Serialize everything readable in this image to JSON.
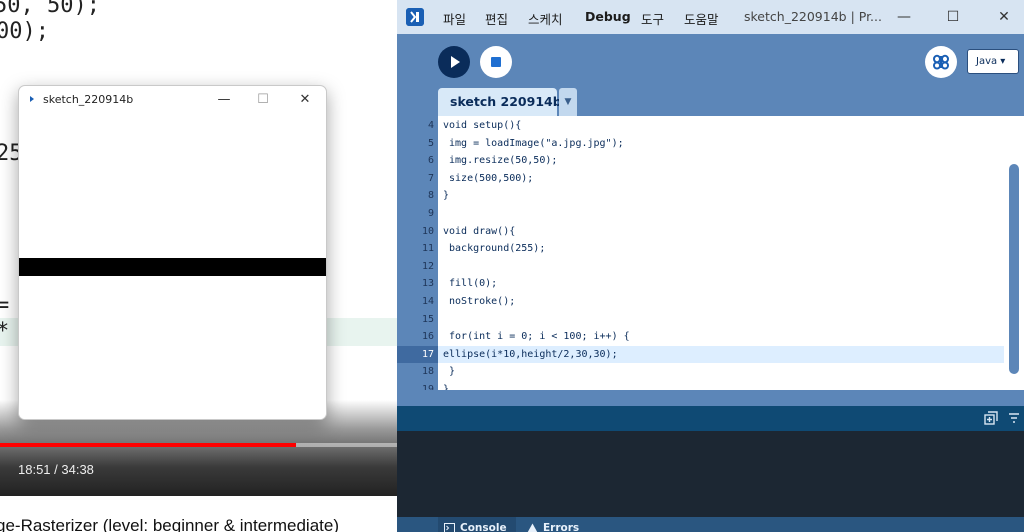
{
  "background_video": {
    "code_lines": [
      "50, 50);",
      "00);",
      "25",
      "=",
      "*"
    ],
    "time": "18:51 / 34:38",
    "progress_fraction": 0.745,
    "caption": "ge-Rasterizer (level: beginner & intermediate)"
  },
  "sketch_window": {
    "title": "sketch_220914b",
    "controls": {
      "minimize": "—",
      "maximize": "☐",
      "close": "✕"
    }
  },
  "ide": {
    "menu": [
      "파일",
      "편집",
      "스케치",
      "Debug",
      "도구",
      "도움말"
    ],
    "title": "sketch_220914b | Pr...",
    "controls": {
      "minimize": "—",
      "maximize": "☐",
      "close": "✕"
    },
    "mode": "Java ▾",
    "tab": {
      "name": "sketch 220914b",
      "menu": "▼"
    },
    "code": [
      {
        "ln": "4",
        "text": "void setup(){"
      },
      {
        "ln": "5",
        "text": " img = loadImage(\"a.jpg.jpg\");"
      },
      {
        "ln": "6",
        "text": " img.resize(50,50);"
      },
      {
        "ln": "7",
        "text": " size(500,500);"
      },
      {
        "ln": "8",
        "text": "}"
      },
      {
        "ln": "9",
        "text": ""
      },
      {
        "ln": "10",
        "text": "void draw(){"
      },
      {
        "ln": "11",
        "text": " background(255);"
      },
      {
        "ln": "12",
        "text": ""
      },
      {
        "ln": "13",
        "text": " fill(0);"
      },
      {
        "ln": "14",
        "text": " noStroke();"
      },
      {
        "ln": "15",
        "text": ""
      },
      {
        "ln": "16",
        "text": " for(int i = 0; i < 100; i++) {"
      },
      {
        "ln": "17",
        "text": "ellipse(i*10,height/2,30,30);"
      },
      {
        "ln": "18",
        "text": " }"
      },
      {
        "ln": "19",
        "text": "}"
      }
    ],
    "highlight_line": "17",
    "bottom_tabs": {
      "console": "Console",
      "errors": "Errors"
    }
  },
  "colors": {
    "ide_blue": "#5c86b8",
    "console_bg": "#1c2733",
    "progress_red": "#ff0000"
  }
}
